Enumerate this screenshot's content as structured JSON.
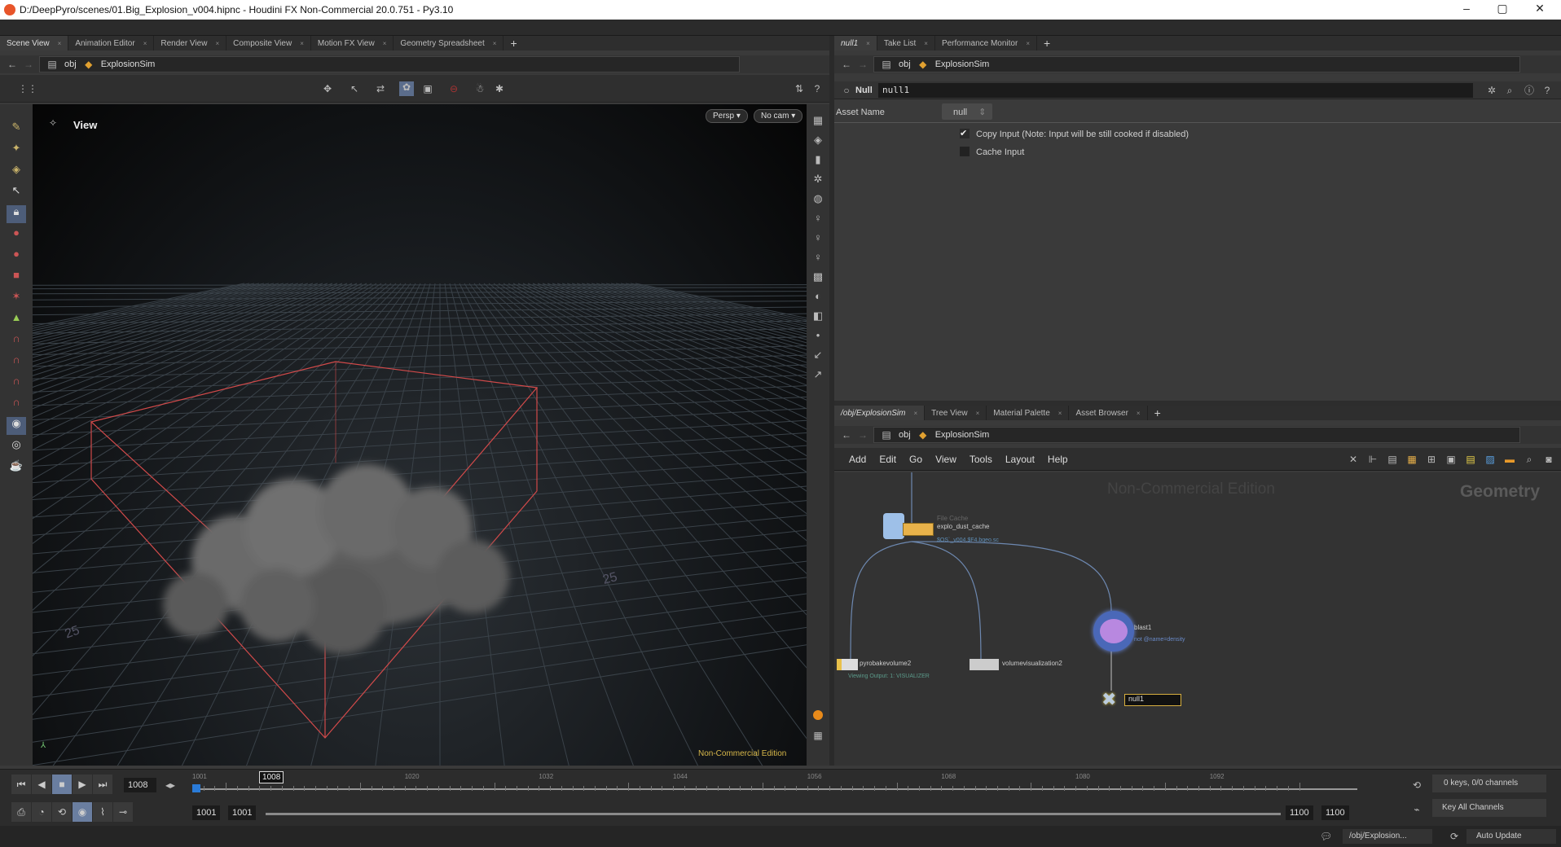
{
  "window": {
    "title": "D:/DeepPyro/scenes/01.Big_Explosion_v004.hipnc - Houdini FX Non-Commercial 20.0.751 - Py3.10",
    "minimize": "–",
    "maximize": "▢",
    "close": "✕"
  },
  "left_pane": {
    "tabs": [
      {
        "label": "Scene View"
      },
      {
        "label": "Animation Editor"
      },
      {
        "label": "Render View"
      },
      {
        "label": "Composite View"
      },
      {
        "label": "Motion FX View"
      },
      {
        "label": "Geometry Spreadsheet"
      }
    ],
    "path": {
      "root": "obj",
      "node": "ExplosionSim"
    },
    "viewport": {
      "title": "View",
      "persp": "Persp ▾",
      "camera": "No cam ▾",
      "watermark": "Non-Commercial Edition",
      "grid_labels": [
        "25",
        "25"
      ]
    }
  },
  "param_pane": {
    "tabs": [
      {
        "label": "null1"
      },
      {
        "label": "Take List"
      },
      {
        "label": "Performance Monitor"
      }
    ],
    "path": {
      "root": "obj",
      "node": "ExplosionSim"
    },
    "node_type": "Null",
    "node_name": "null1",
    "asset_name_label": "Asset Name",
    "asset_name_value": "null",
    "copy_input": {
      "label": "Copy Input (Note: Input will be still cooked if disabled)",
      "checked": true
    },
    "cache_input": {
      "label": "Cache Input",
      "checked": false
    }
  },
  "network_pane": {
    "tabs": [
      {
        "label": "/obj/ExplosionSim"
      },
      {
        "label": "Tree View"
      },
      {
        "label": "Material Palette"
      },
      {
        "label": "Asset Browser"
      }
    ],
    "path": {
      "root": "obj",
      "node": "ExplosionSim"
    },
    "menu": [
      "Add",
      "Edit",
      "Go",
      "View",
      "Tools",
      "Layout",
      "Help"
    ],
    "watermark": "Non-Commercial Edition",
    "context": "Geometry",
    "nodes": {
      "cache": {
        "type": "File Cache",
        "name": "explo_dust_cache",
        "sub": "$OS`_v004.$F4.bgeo.sc"
      },
      "pyro": {
        "name": "pyrobakevolume2",
        "sub": "Viewing Output: 1: VISUALIZER"
      },
      "vis": {
        "name": "volumevisualization2"
      },
      "blast": {
        "name": "blast1",
        "sub": "not @name=density"
      },
      "null": {
        "name": "null1"
      }
    }
  },
  "timeline": {
    "current_frame": "1008",
    "frame_marker": "1008",
    "start": 1001,
    "end": 1100,
    "tick_labels": [
      1001,
      1020,
      1032,
      1044,
      1056,
      1068,
      1080,
      1092
    ],
    "range_start": "1001",
    "range_start2": "1001",
    "range_end": "1100",
    "range_end2": "1100",
    "keys_info": "0 keys, 0/0 channels",
    "key_all": "Key All Channels"
  },
  "status": {
    "path": "/obj/Explosion...",
    "update": "Auto Update"
  }
}
